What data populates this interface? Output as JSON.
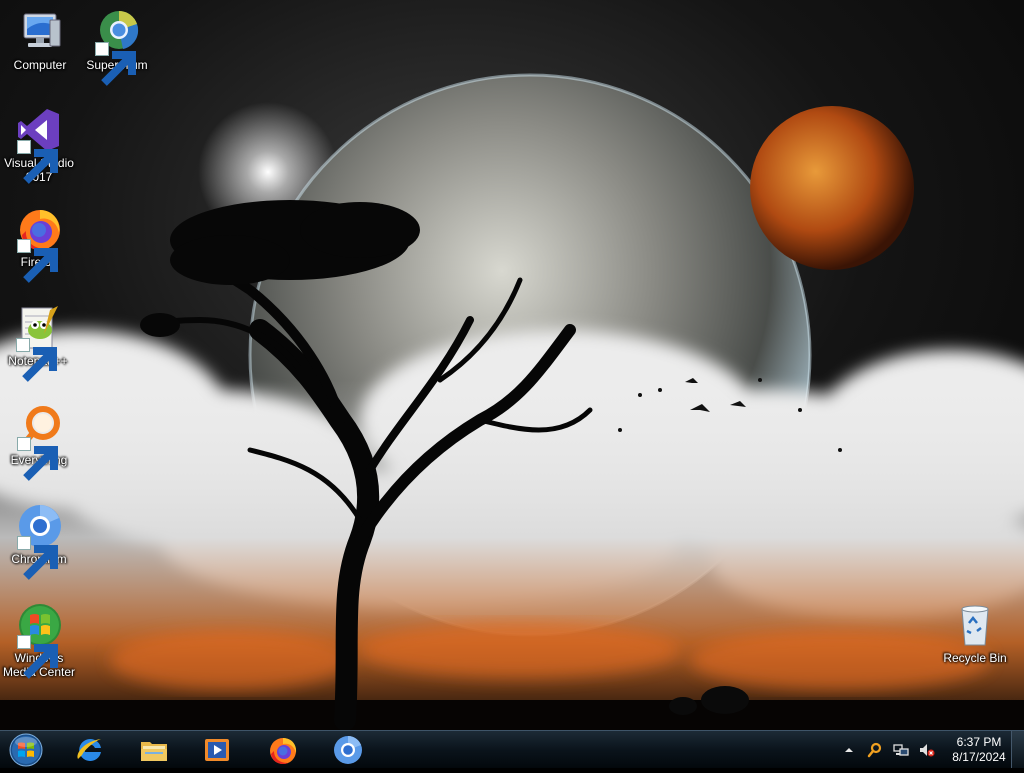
{
  "desktop": {
    "icons": [
      {
        "id": "computer",
        "label": "Computer"
      },
      {
        "id": "supermium",
        "label": "Supermium"
      },
      {
        "id": "visual-studio",
        "label": "Visual Studio 2017"
      },
      {
        "id": "firefox",
        "label": "Firefox"
      },
      {
        "id": "notepadpp",
        "label": "Notepad++"
      },
      {
        "id": "everything",
        "label": "Everything"
      },
      {
        "id": "chromium",
        "label": "Chromium"
      },
      {
        "id": "media-center",
        "label": "Windows Media Center"
      },
      {
        "id": "recycle-bin",
        "label": "Recycle Bin"
      }
    ]
  },
  "taskbar": {
    "start_icon": "windows-orb-icon",
    "pinned": [
      {
        "name": "Internet Explorer",
        "icon": "internet-explorer-icon"
      },
      {
        "name": "File Explorer",
        "icon": "folder-icon"
      },
      {
        "name": "Windows Media Player",
        "icon": "media-player-icon"
      },
      {
        "name": "Firefox",
        "icon": "firefox-icon"
      },
      {
        "name": "Chromium",
        "icon": "chromium-icon"
      }
    ],
    "tray": {
      "icons": [
        "show-hidden-icons-arrow",
        "search-icon",
        "network-icon",
        "volume-muted-icon"
      ],
      "time": "6:37 PM",
      "date": "8/17/2024"
    }
  },
  "colors": {
    "taskbar": "#0b141c",
    "accent": "#3a7bd5"
  }
}
